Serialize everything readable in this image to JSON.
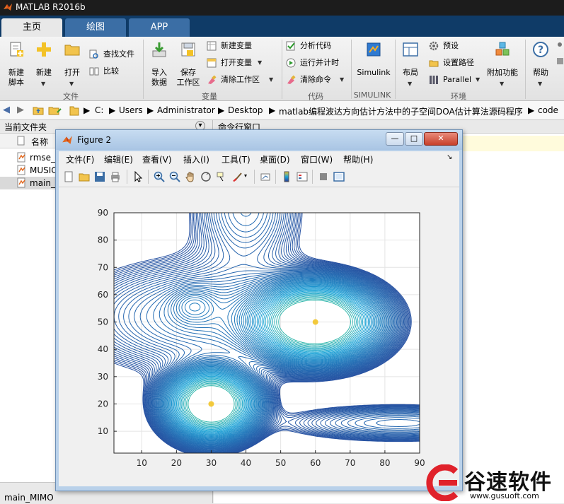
{
  "window": {
    "title": "MATLAB R2016b"
  },
  "tabs": [
    {
      "label": "主页",
      "active": true
    },
    {
      "label": "绘图",
      "active": false
    },
    {
      "label": "APP",
      "active": false
    }
  ],
  "ribbon": {
    "new_script_line1": "新建",
    "new_script_line2": "脚本",
    "new": "新建",
    "open": "打开",
    "find_files": "查找文件",
    "compare": "比较",
    "import_line1": "导入",
    "import_line2": "数据",
    "save_ws_line1": "保存",
    "save_ws_line2": "工作区",
    "new_var": "新建变量",
    "open_var": "打开变量",
    "clear_ws": "清除工作区",
    "analyze": "分析代码",
    "run_time": "运行并计时",
    "clear_cmd": "清除命令",
    "simulink": "Simulink",
    "layout": "布局",
    "prefs": "预设",
    "set_path": "设置路径",
    "parallel": "Parallel",
    "addons": "附加功能",
    "help": "帮助",
    "groups": {
      "file": "文件",
      "variable": "变量",
      "code": "代码",
      "simulink": "SIMULINK",
      "env": "环境"
    }
  },
  "address": {
    "crumbs": [
      "C:",
      "Users",
      "Administrator",
      "Desktop",
      "matlab编程波达方向估计方法中的子空间DOA估计算法源码程序",
      "code"
    ]
  },
  "left_panel": {
    "title": "当前文件夹",
    "column_name": "名称",
    "files": [
      "rmse_",
      "MUSIC",
      "main_"
    ],
    "footer": "main_MIMO"
  },
  "command_window": {
    "title": "命令行窗口"
  },
  "figure": {
    "title": "Figure 2",
    "menus": [
      "文件(F)",
      "编辑(E)",
      "查看(V)",
      "插入(I)",
      "工具(T)",
      "桌面(D)",
      "窗口(W)",
      "帮助(H)"
    ],
    "min": "—",
    "max": "□",
    "close": "✕"
  },
  "chart_data": {
    "type": "contour",
    "xlim": [
      2,
      90
    ],
    "ylim": [
      2,
      90
    ],
    "xticks": [
      10,
      20,
      30,
      40,
      50,
      60,
      70,
      80,
      90
    ],
    "yticks": [
      10,
      20,
      30,
      40,
      50,
      60,
      70,
      80,
      90
    ],
    "grid": true,
    "peaks": [
      {
        "x": 30,
        "y": 20
      },
      {
        "x": 60,
        "y": 50
      }
    ],
    "colors": {
      "low": "#2b3a91",
      "mid": "#1aa3d8",
      "high": "#f2c428"
    }
  },
  "watermark": {
    "brand": "谷速软件",
    "url": "www.gusuoft.com"
  },
  "colors": {
    "tab_active": "#e8e8e8",
    "tabbar": "#0f3b67",
    "titlebar": "#1c1c1c",
    "brand_red": "#e0222b"
  }
}
